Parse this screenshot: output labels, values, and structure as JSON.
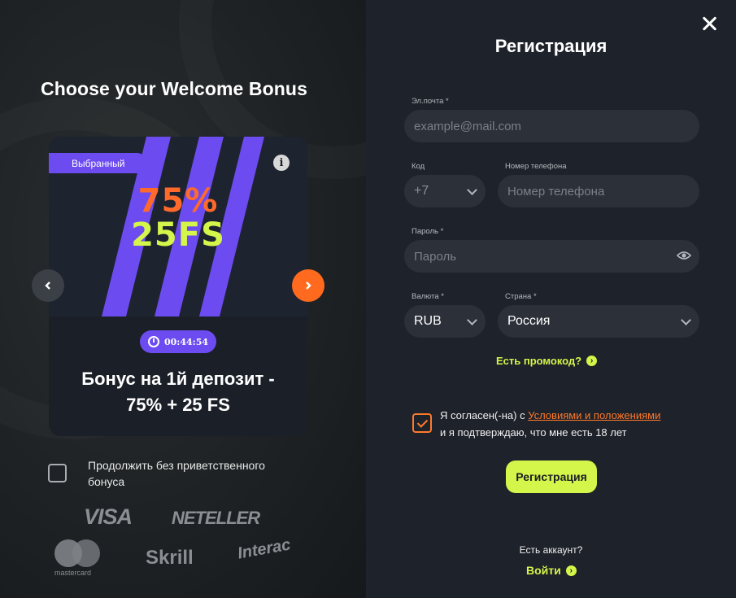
{
  "bonus": {
    "title": "Choose your Welcome Bonus",
    "selected_badge": "Выбранный",
    "info_icon": "info-icon",
    "promo_percent": "75%",
    "promo_fs": "25FS",
    "timer": "00:44:54",
    "description": "Бонус на 1й депозит - 75% + 25 FS",
    "skip_label": "Продолжить без приветственного бонуса"
  },
  "payments": {
    "visa": "VISA",
    "neteller": "NETELLER",
    "mastercard": "mastercard",
    "skrill": "Skrill",
    "interac": "Interac"
  },
  "form": {
    "title": "Регистрация",
    "email_label": "Эл.почта *",
    "email_placeholder": "example@mail.com",
    "code_label": "Код",
    "code_value": "+7",
    "phone_label": "Номер телефона",
    "phone_placeholder": "Номер телефона",
    "password_label": "Пароль *",
    "password_placeholder": "Пароль",
    "currency_label": "Валюта *",
    "currency_value": "RUB",
    "country_label": "Страна *",
    "country_value": "Россия",
    "promo_link": "Есть промокод?",
    "agree_prefix": "Я согласен(-на) с ",
    "agree_link": "Условиями и положениями",
    "agree_suffix": "и я подтверждаю, что мне есть 18 лет",
    "agree_checked": true,
    "submit": "Регистрация",
    "have_account": "Есть аккаунт?",
    "login": "Войти"
  },
  "colors": {
    "accent_green": "#d4f54a",
    "accent_orange": "#ff6a1f",
    "accent_purple": "#6c4cf0"
  }
}
